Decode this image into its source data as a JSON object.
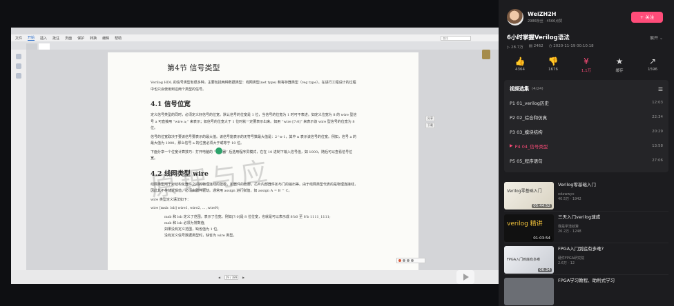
{
  "pdf_viewer": {
    "menu": [
      "文件",
      "开始",
      "插入",
      "批注",
      "页面",
      "保护",
      "转换",
      "编辑",
      "帮助"
    ],
    "search_placeholder": "查找",
    "doc_heading": "第4节  信号类型",
    "intro": "Verilog HDL 的信号类型有很多种，主要包括两种数据类型：线网类型(net type) 和寄存器类型（reg type）。在进行工程设计的过程中也只会使用到这两个类型的信号。",
    "section1_title": "4.1  信号位宽",
    "section1_p1": "定义信号类型的同时，必须定义好信号的位宽。默认信号的位宽是 1 位，当信号的位宽为 1 时可不表述。如定义位宽为 8 的 wire 型信号 a 可直接用 “wire  a;” 来表示；如信号的位宽大于 1 位时就一定要表示出来。如用 “wire [7:0]” 来表示该 wire 型信号的位宽为 8 位。",
    "section1_p2": "信号的位宽取决于要该信号要表示的最大值。该信号能表示的无符号数最大值是：2^n-1，其中 n 表示该信号的位宽。例如，信号 a 的最大值为 1000，那么信号 a 的位宽必须大于或等于 10 位。",
    "section1_p3": "下面分享一个位宽计算技巧：打开电脑的 “计算器” 后选用程序员模式，在在 10 进制下输入信号值，如 1000，随后可以查看信号位宽。",
    "section2_title": "4.2  线网类型 wire",
    "section2_p1": "线网类型用于对结构化器件之间的物理连线的建模，如器件的管脚，芯片内部器件如与门的输出等。由于线网类型代表的是物理连接线，因此其不存储逻辑值，必须由器件驱动。通常用 assign 进行赋值，如  assign   A  =  B ^ C。",
    "section2_lines": [
      "wire  类型定义语法如下：",
      "wire   [msb: lsb]  wire1,  wire2,  ...  ,wireN;"
    ],
    "section2_bullets": [
      "msb 和 lsb 定义了范围，表示了位宽。例如[7:0]是 8 位位宽，也就是可以表示成 8'b0 至 8'b 1111_1111;",
      "msb 和 lsb 必须为常数值;",
      "如果没有定义范围，缺省值为 1 位;",
      "没有定义信号数据类型时，缺省为 wire 类型。"
    ],
    "watermark": "原理与应",
    "page_indicator": "29 / 389",
    "side_btn_a": "分享",
    "side_btn_b": "下载"
  },
  "bili": {
    "up_name": "WeiZH2H",
    "up_stats": "2986粉丝 · 4566点赞",
    "follow_label": "+ 关注",
    "video_title": "6小时掌握Verilog语法",
    "expand_label": "展开",
    "views": "28.7万",
    "danmaku": "2462",
    "date": "2020-11-19 00:10:18",
    "actions": [
      {
        "icon": "👍",
        "count": "4364"
      },
      {
        "icon": "👎",
        "count": "1676"
      },
      {
        "icon": "¥",
        "count": "1.1万"
      },
      {
        "icon": "★",
        "count": "缓存"
      },
      {
        "icon": "↗",
        "count": "1596"
      }
    ],
    "playlist_title": "视频选集",
    "playlist_count": "(4/24)",
    "episodes": [
      {
        "label": "P1  01_verilog历史",
        "dur": "12:03"
      },
      {
        "label": "P2  02_综合和仿真",
        "dur": "22:34"
      },
      {
        "label": "P3  03_模块结构",
        "dur": "20:29"
      },
      {
        "label": "P4  04_信号类型",
        "dur": "13:58"
      },
      {
        "label": "P5  05_程序语句",
        "dur": "27:06"
      }
    ],
    "recommendations": [
      {
        "title": "Verilog零基础入门",
        "up": "edawwyo",
        "stats": "40.5万 · 1942",
        "dur": "05:44:52",
        "thumb_text": "Verilog零基础入门"
      },
      {
        "title": "三天入门verilog速成",
        "up": "我是学渣就算",
        "stats": "26.2万 · 1248",
        "dur": "01:03:54",
        "thumb_text": "verilog 精讲"
      },
      {
        "title": "FPGA入门到底有多难?",
        "up": "硬件FPGA研究院",
        "stats": "2.6万 · 12",
        "dur": "06:34",
        "thumb_text": "FPGA入门到底有多难"
      },
      {
        "title": "FPGA学习教程、助利式学习",
        "up": "",
        "stats": "",
        "dur": "",
        "thumb_text": ""
      }
    ]
  }
}
